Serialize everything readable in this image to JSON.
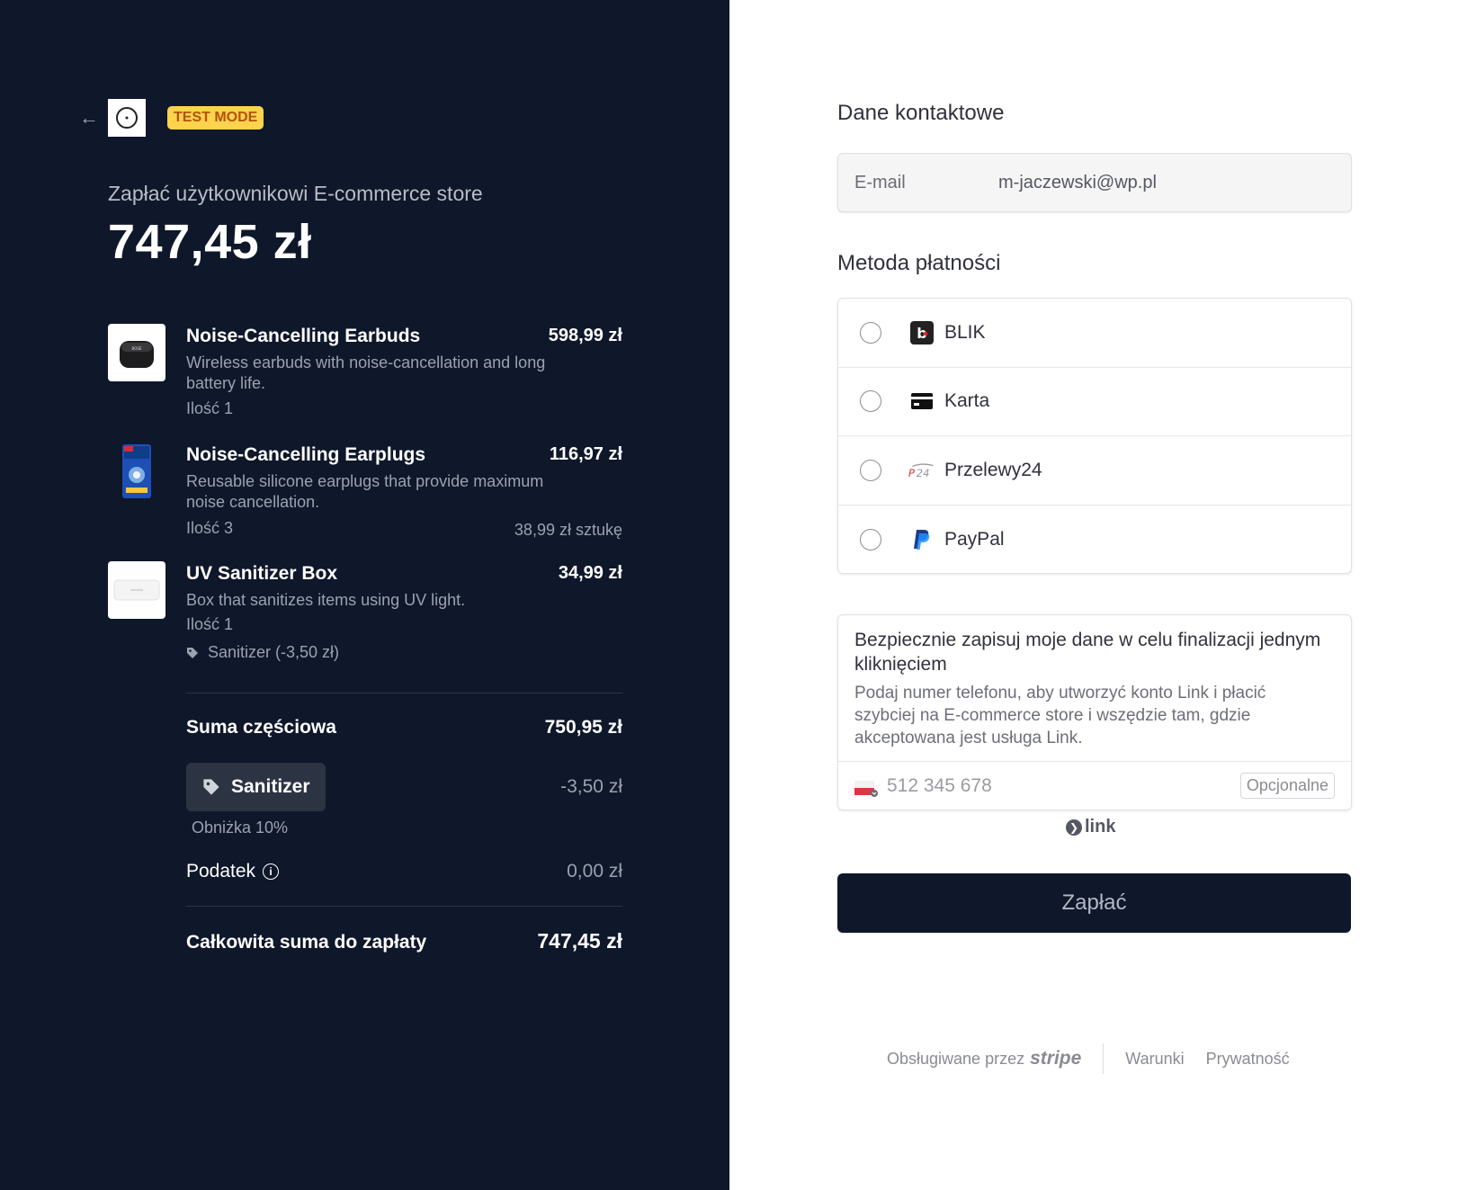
{
  "header": {
    "badge": "TEST MODE"
  },
  "summary": {
    "merchant_line": "Zapłać użytkownikowi E-commerce store",
    "total": "747,45 zł"
  },
  "items": [
    {
      "name": "Noise-Cancelling Earbuds",
      "price": "598,99 zł",
      "description": "Wireless earbuds with noise-cancellation and long battery life.",
      "qty": "Ilość 1"
    },
    {
      "name": "Noise-Cancelling Earplugs",
      "price": "116,97 zł",
      "description": "Reusable silicone earplugs that provide maximum noise cancellation.",
      "qty": "Ilość 3",
      "unit_price": "38,99 zł sztukę"
    },
    {
      "name": "UV Sanitizer Box",
      "price": "34,99 zł",
      "description": "Box that sanitizes items using UV light.",
      "qty": "Ilość 1",
      "discount": "Sanitizer (-3,50 zł)"
    }
  ],
  "totals": {
    "subtotal_label": "Suma częściowa",
    "subtotal": "750,95 zł",
    "promo_code": "Sanitizer",
    "promo_amount": "-3,50 zł",
    "promo_desc": "Obniżka 10%",
    "tax_label": "Podatek",
    "tax": "0,00 zł",
    "total_label": "Całkowita suma do zapłaty",
    "total": "747,45 zł"
  },
  "contact": {
    "title": "Dane kontaktowe",
    "email_label": "E-mail",
    "email_value": "m-jaczewski@wp.pl"
  },
  "payment": {
    "title": "Metoda płatności",
    "methods": [
      {
        "label": "BLIK",
        "icon": "blik-icon"
      },
      {
        "label": "Karta",
        "icon": "card-icon"
      },
      {
        "label": "Przelewy24",
        "icon": "przelewy24-icon"
      },
      {
        "label": "PayPal",
        "icon": "paypal-icon"
      }
    ]
  },
  "link": {
    "title": "Bezpiecznie zapisuj moje dane w celu finalizacji jednym kliknięciem",
    "description": "Podaj numer telefonu, aby utworzyć konto Link i płacić szybciej na E-commerce store i wszędzie tam, gdzie akceptowana jest usługa Link.",
    "phone_placeholder": "512 345 678",
    "optional": "Opcjonalne",
    "brand": "link"
  },
  "pay_button": "Zapłać",
  "footer": {
    "powered_by": "Obsługiwane przez",
    "stripe": "stripe",
    "terms": "Warunki",
    "privacy": "Prywatność"
  },
  "colors": {
    "left_bg": "#0f172a",
    "badge_bg": "#fcd34d",
    "badge_text": "#b45309",
    "button_bg": "#0f172a"
  }
}
